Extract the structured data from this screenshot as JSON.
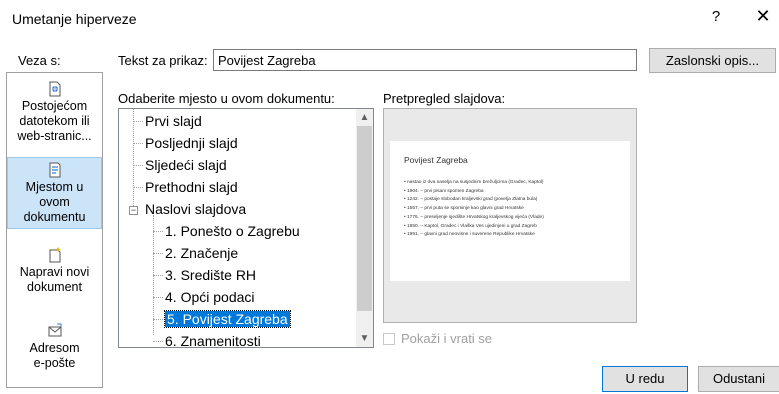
{
  "title": "Umetanje hiperveze",
  "help": "?",
  "close": "✕",
  "link_to": {
    "label": "Veza s:",
    "items": [
      {
        "line1": "Postojećom",
        "line2": "datotekom ili",
        "line3": "web-stranic...",
        "icon": "existing-file-icon"
      },
      {
        "line1": "Mjestom u",
        "line2": "ovom",
        "line3": "dokumentu",
        "icon": "place-in-document-icon",
        "selected": true
      },
      {
        "line1": "Napravi novi",
        "line2": "dokument",
        "icon": "new-document-icon"
      },
      {
        "line1": "Adresom",
        "line2": "e-pošte",
        "icon": "email-icon"
      }
    ]
  },
  "display_text": {
    "label": "Tekst za prikaz:",
    "value": "Povijest Zagreba"
  },
  "screentip_button": "Zaslonski opis...",
  "place": {
    "label": "Odaberite mjesto u ovom dokumentu:",
    "items": [
      "Prvi slajd",
      "Posljednji slajd",
      "Sljedeći slajd",
      "Prethodni slajd",
      "Naslovi slajdova",
      "1. Ponešto o Zagrebu",
      "2. Značenje",
      "3. Središte RH",
      "4. Opći podaci",
      "5. Povijest Zagreba",
      "6. Znamenitosti"
    ],
    "selected": "5. Povijest Zagreba"
  },
  "preview": {
    "label": "Pretpregled slajdova:",
    "slide_title": "Povijest Zagreba",
    "bullets": [
      "• nastao iz dva naselja na susjednim brežuljcima (Gradec, Kaptol)",
      "• 1904. – prvi pisani spomen Zagreba",
      "• 1242. – postaje slobodan kraljevski grad (povelja Zlatna bula)",
      "• 1557. – prvi puta se spominje kao glavni grad Hrvatske",
      "• 1776. – preseljenje sjedište Hrvatskog kraljevskog vijeća (Vlade)",
      "• 1850. – Kaptol, Gradec i Vlaška Ves ujedinjeni u grad Zagreb",
      "• 1991. – glavni grad neovisne i suverene Republike Hrvatske"
    ]
  },
  "show_and_return": "Pokaži i vrati se",
  "ok_button": "U redu",
  "cancel_button": "Odustani",
  "colors": {
    "selection": "#0078d7",
    "selected_tile": "#cce4f7"
  }
}
